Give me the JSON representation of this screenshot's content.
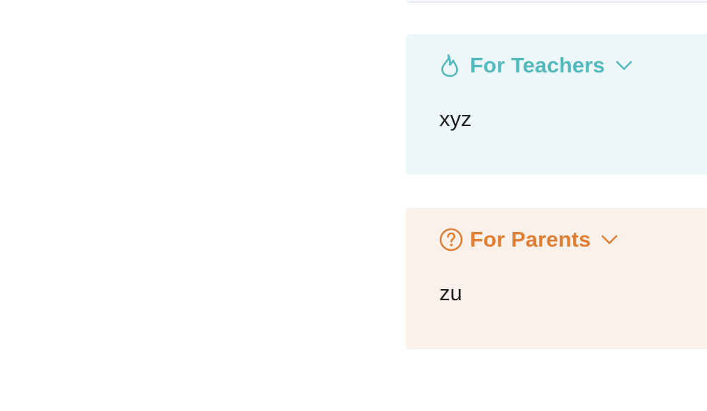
{
  "callouts": [
    {
      "title": "For Teachers",
      "icon": "flame-icon",
      "body": "xyz",
      "accent": "#52b9bf",
      "background": "#edf7f8"
    },
    {
      "title": "For Parents",
      "icon": "question-circle-icon",
      "body": "zu",
      "accent": "#e07e33",
      "background": "#fcf1ea"
    }
  ]
}
